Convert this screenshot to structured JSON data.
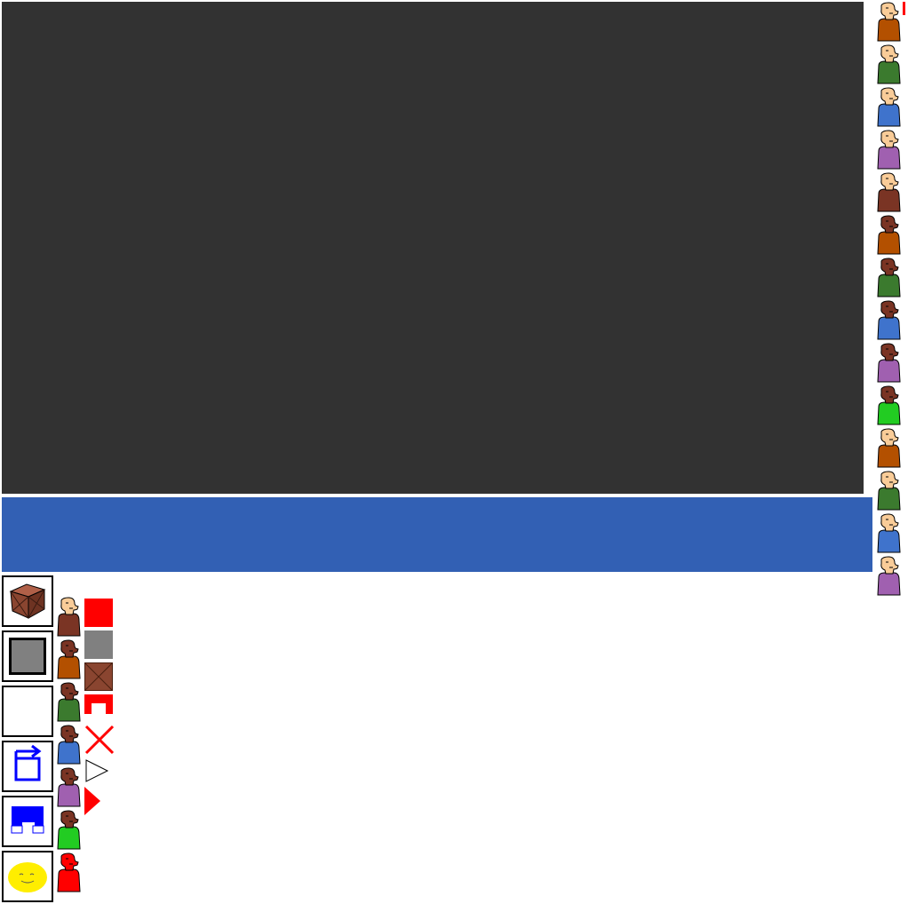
{
  "colors": {
    "canvas": "#323232",
    "chat_bar": "#3260b4",
    "skin_light": "#f9cc98",
    "skin_dark": "#7a3424",
    "red": "#ff0000",
    "gray": "#808080",
    "crate": "#8a4530",
    "blue_icon": "#0000ff",
    "smiley": "#ffee00"
  },
  "player_list": [
    {
      "skin": "light",
      "shirt": "#b35000"
    },
    {
      "skin": "light",
      "shirt": "#3b7a2e"
    },
    {
      "skin": "light",
      "shirt": "#3f73cc"
    },
    {
      "skin": "light",
      "shirt": "#a060b0"
    },
    {
      "skin": "light",
      "shirt": "#7a3424"
    },
    {
      "skin": "dark",
      "shirt": "#b35000"
    },
    {
      "skin": "dark",
      "shirt": "#3b7a2e"
    },
    {
      "skin": "dark",
      "shirt": "#3f73cc"
    },
    {
      "skin": "dark",
      "shirt": "#a060b0"
    },
    {
      "skin": "dark",
      "shirt": "#22cc22"
    },
    {
      "skin": "light",
      "shirt": "#b35000"
    },
    {
      "skin": "light",
      "shirt": "#3b7a2e"
    },
    {
      "skin": "light",
      "shirt": "#3f73cc"
    },
    {
      "skin": "light",
      "shirt": "#a060b0"
    }
  ],
  "toolbar_tools": [
    {
      "name": "crate-block-tool",
      "icon": "crate-icon"
    },
    {
      "name": "stone-block-tool",
      "icon": "stone-block-icon"
    },
    {
      "name": "empty-tool",
      "icon": "blank-icon"
    },
    {
      "name": "rotate-tool",
      "icon": "rotate-icon"
    },
    {
      "name": "bridge-tool",
      "icon": "bridge-icon"
    },
    {
      "name": "smiley-tool",
      "icon": "smiley-icon"
    }
  ],
  "avatar_picker": [
    {
      "skin": "light",
      "shirt": "#7a3424"
    },
    {
      "skin": "dark",
      "shirt": "#b35000"
    },
    {
      "skin": "dark",
      "shirt": "#3b7a2e"
    },
    {
      "skin": "dark",
      "shirt": "#3f73cc"
    },
    {
      "skin": "dark",
      "shirt": "#a060b0"
    },
    {
      "skin": "dark",
      "shirt": "#22cc22"
    },
    {
      "skin": "red",
      "shirt": "#ff0000"
    }
  ],
  "palette": [
    {
      "name": "red-square-swatch",
      "icon": "red-square-icon"
    },
    {
      "name": "gray-square-swatch",
      "icon": "gray-square-icon"
    },
    {
      "name": "crate-swatch",
      "icon": "crate-icon"
    },
    {
      "name": "red-arch-swatch",
      "icon": "arch-icon"
    },
    {
      "name": "delete-swatch",
      "icon": "x-icon"
    },
    {
      "name": "white-pointer-swatch",
      "icon": "triangle-outline-icon"
    },
    {
      "name": "red-pointer-swatch",
      "icon": "triangle-red-icon"
    }
  ]
}
